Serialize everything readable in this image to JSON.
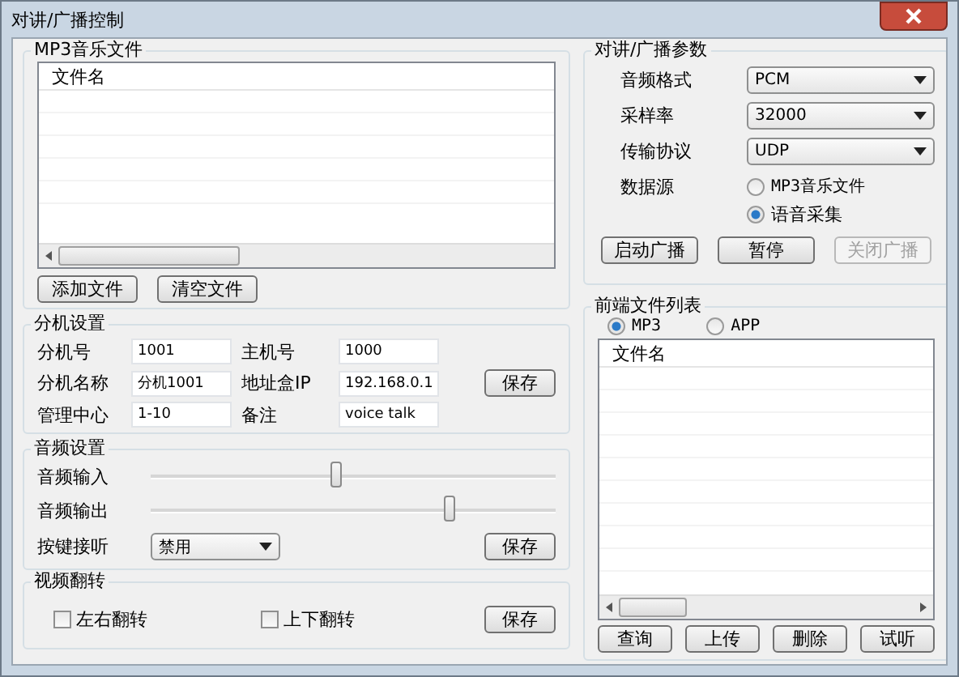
{
  "window": {
    "title": "对讲/广播控制"
  },
  "mp3_files": {
    "title": "MP3音乐文件",
    "columns": [
      "文件名"
    ],
    "buttons": [
      "添加文件",
      "清空文件"
    ]
  },
  "extension_settings": {
    "title": "分机设置",
    "rows": [
      {
        "fields": [
          {
            "label": "分机号",
            "value": "1001"
          },
          {
            "label": "主机号",
            "value": "1000"
          }
        ]
      },
      {
        "fields": [
          {
            "label": "分机名称",
            "value": "分机1001"
          },
          {
            "label": "地址盒IP",
            "value": "192.168.0.1"
          }
        ]
      },
      {
        "fields": [
          {
            "label": "管理中心",
            "value": "1-10"
          },
          {
            "label": "备注",
            "value": "voice talk"
          }
        ]
      }
    ],
    "save": "保存"
  },
  "audio_settings": {
    "title": "音频设置",
    "sliders": [
      {
        "label": "音频输入",
        "level": 0.46
      },
      {
        "label": "音频输出",
        "level": 0.74
      }
    ],
    "key_listen": {
      "label": "按键接听",
      "value": "禁用"
    },
    "save": "保存"
  },
  "video_flip": {
    "title": "视频翻转",
    "options": [
      {
        "label": "左右翻转",
        "checked": false
      },
      {
        "label": "上下翻转",
        "checked": false
      }
    ],
    "save": "保存"
  },
  "params": {
    "title": "对讲/广播参数",
    "dropdowns": [
      {
        "label": "音频格式",
        "value": "PCM"
      },
      {
        "label": "采样率",
        "value": "32000"
      },
      {
        "label": "传输协议",
        "value": "UDP"
      }
    ],
    "source": {
      "label": "数据源",
      "options": [
        {
          "label": "MP3音乐文件",
          "selected": false
        },
        {
          "label": "语音采集",
          "selected": true
        }
      ]
    },
    "buttons": [
      {
        "label": "启动广播",
        "disabled": false
      },
      {
        "label": "暂停",
        "disabled": false
      },
      {
        "label": "关闭广播",
        "disabled": true
      }
    ]
  },
  "remote_files": {
    "title": "前端文件列表",
    "types": [
      {
        "label": "MP3",
        "selected": true
      },
      {
        "label": "APP",
        "selected": false
      }
    ],
    "columns": [
      "文件名"
    ],
    "buttons": [
      "查询",
      "上传",
      "删除",
      "试听"
    ]
  }
}
